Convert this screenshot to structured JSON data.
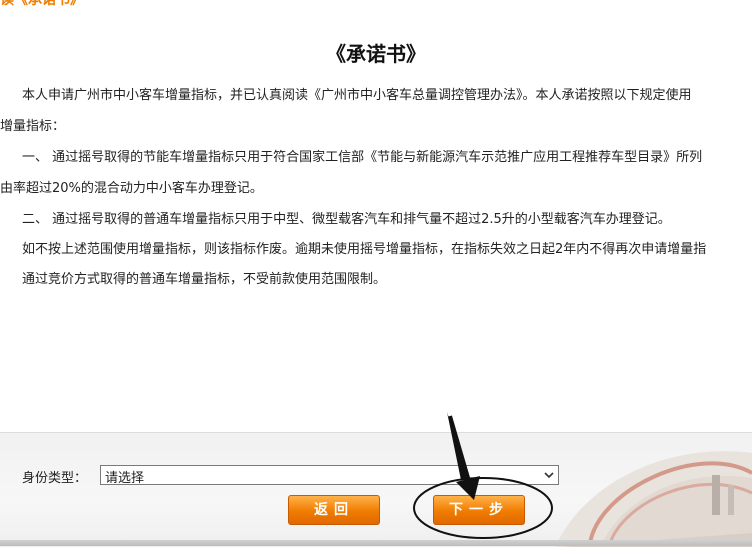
{
  "top_link": "阅读《承诺书》",
  "title": "《承诺书》",
  "paragraphs": [
    "本人申请广州市中小客车增量指标，并已认真阅读《广州市中小客车总量调控管理办法》。本人承诺按照以下规定使用",
    "增量指标：",
    "一、 通过摇号取得的节能车增量指标只用于符合国家工信部《节能与新能源汽车示范推广应用工程推荐车型目录》所列",
    "由率超过20%的混合动力中小客车办理登记。",
    "二、 通过摇号取得的普通车增量指标只用于中型、微型载客汽车和排气量不超过2.5升的小型载客汽车办理登记。",
    "如不按上述范围使用增量指标，则该指标作废。逾期未使用摇号增量指标，在指标失效之日起2年内不得再次申请增量指",
    "通过竞价方式取得的普通车增量指标，不受前款使用范围限制。"
  ],
  "form": {
    "id_type_label": "身份类型：",
    "id_type_value": "请选择"
  },
  "buttons": {
    "back": "返回",
    "next": "下一步"
  },
  "colors": {
    "accent": "#f07c00",
    "annotation": "#111111"
  },
  "icons": {
    "select_arrow": "chevron-down-icon"
  }
}
